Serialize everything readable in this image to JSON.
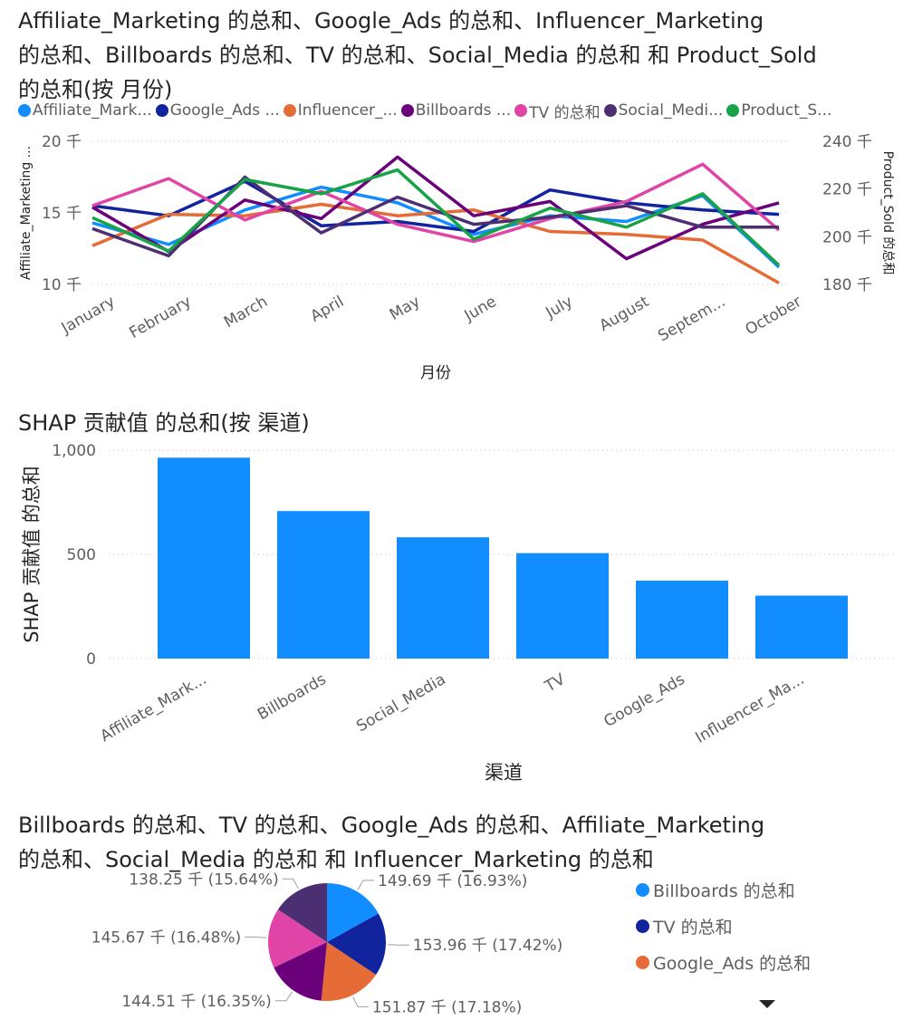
{
  "charts": {
    "line": {
      "title": "Affiliate_Marketing 的总和、Google_Ads 的总和、Influencer_Marketing 的总和、Billboards 的总和、TV 的总和、Social_Media 的总和 和 Product_Sold 的总和(按 月份)",
      "title_lines": [
        "Affiliate_Marketing 的总和、Google_Ads 的总和、Influencer_Marketing",
        "的总和、Billboards 的总和、TV 的总和、Social_Media 的总和 和 Product_Sold",
        "的总和(按 月份)"
      ],
      "legend_labels": [
        "Affiliate_Mark...",
        "Google_Ads ...",
        "Influencer_...",
        "Billboards ...",
        "TV 的总和",
        "Social_Medi...",
        "Product_S..."
      ]
    },
    "bar": {
      "title": "SHAP 贡献值 的总和(按 渠道)",
      "ylabel": "SHAP 贡献值 的总和",
      "xlabel": "渠道",
      "tick_labels": [
        "Affiliate_Mark...",
        "Billboards",
        "Social_Media",
        "TV",
        "Google_Ads",
        "Influencer_Ma..."
      ]
    },
    "pie": {
      "title_lines": [
        "Billboards 的总和、TV 的总和、Google_Ads 的总和、Affiliate_Marketing",
        "的总和、Social_Media 的总和 和 Influencer_Marketing 的总和"
      ],
      "legend_labels": [
        "Billboards 的总和",
        "TV 的总和",
        "Google_Ads 的总和"
      ]
    }
  },
  "chart_data": [
    {
      "type": "line",
      "title": "Affiliate_Marketing 的总和、Google_Ads 的总和、Influencer_Marketing 的总和、Billboards 的总和、TV 的总和、Social_Media 的总和 和 Product_Sold 的总和(按 月份)",
      "xlabel": "月份",
      "ylabel": "Affiliate_Marketing ...",
      "y2label": "Product_Sold 的总和",
      "categories": [
        "January",
        "February",
        "March",
        "April",
        "May",
        "June",
        "July",
        "August",
        "Septem...",
        "October"
      ],
      "ylim": [
        10000,
        20000
      ],
      "y_ticks": [
        "10 千",
        "15 千",
        "20 千"
      ],
      "y2lim": [
        180,
        240
      ],
      "y2_ticks": [
        "180 千",
        "200 千",
        "220 千",
        "240 千"
      ],
      "grid": true,
      "legend_position": "top",
      "series": [
        {
          "name": "Affiliate_Mark...",
          "axis": "left",
          "color": "#118DFF",
          "values": [
            14300,
            12800,
            15200,
            16800,
            15700,
            13500,
            14800,
            14400,
            16200,
            11200
          ]
        },
        {
          "name": "Google_Ads ...",
          "axis": "left",
          "color": "#12239E",
          "values": [
            15500,
            14800,
            17200,
            14100,
            14400,
            13700,
            16600,
            15700,
            15200,
            14900
          ]
        },
        {
          "name": "Influencer_...",
          "axis": "left",
          "color": "#E66C37",
          "values": [
            12700,
            14900,
            14800,
            15600,
            14800,
            15200,
            13700,
            13500,
            13100,
            10100
          ]
        },
        {
          "name": "Billboards ...",
          "axis": "left",
          "color": "#6B007B",
          "values": [
            15400,
            12300,
            15900,
            14600,
            18900,
            14800,
            15800,
            11800,
            14200,
            15700
          ]
        },
        {
          "name": "TV 的总和",
          "axis": "left",
          "color": "#E044A7",
          "values": [
            15500,
            17400,
            14500,
            16500,
            14200,
            13000,
            14600,
            15800,
            18400,
            13800
          ]
        },
        {
          "name": "Social_Medi...",
          "axis": "left",
          "color": "#4C2F72",
          "values": [
            13900,
            12000,
            17500,
            13600,
            16100,
            14200,
            14700,
            15500,
            14000,
            14000
          ]
        },
        {
          "name": "Product_S...",
          "axis": "right",
          "color": "#17A346",
          "values": [
            208,
            194,
            224,
            218,
            228,
            199,
            212,
            204,
            218,
            188
          ]
        }
      ]
    },
    {
      "type": "bar",
      "title": "SHAP 贡献值 的总和(按 渠道)",
      "xlabel": "渠道",
      "ylabel": "SHAP 贡献值 的总和",
      "categories": [
        "Affiliate_Mark...",
        "Billboards",
        "Social_Media",
        "TV",
        "Google_Ads",
        "Influencer_Ma..."
      ],
      "values": [
        964,
        708,
        582,
        506,
        374,
        302
      ],
      "ylim": [
        0,
        1000
      ],
      "y_ticks": [
        "0",
        "500",
        "1,000"
      ],
      "grid": true,
      "color": "#118DFF"
    },
    {
      "type": "pie",
      "title": "Billboards 的总和、TV 的总和、Google_Ads 的总和、Affiliate_Marketing 的总和、Social_Media 的总和 和 Influencer_Marketing 的总和",
      "slices": [
        {
          "label": "Billboards 的总和",
          "value": 149.69,
          "color": "#118DFF",
          "data_label": "149.69 千 (16.93%)"
        },
        {
          "label": "TV 的总和",
          "value": 153.96,
          "color": "#12239E",
          "data_label": "153.96 千 (17.42%)"
        },
        {
          "label": "Google_Ads 的总和",
          "value": 151.87,
          "color": "#E66C37",
          "data_label": "151.87 千 (17.18%)"
        },
        {
          "label": "",
          "value": 144.51,
          "color": "#6B007B",
          "data_label": "144.51 千 (16.35%)"
        },
        {
          "label": "",
          "value": 145.67,
          "color": "#E044A7",
          "data_label": "145.67 千 (16.48%)"
        },
        {
          "label": "",
          "value": 138.25,
          "color": "#4C2F72",
          "data_label": "138.25 千 (15.64%)"
        }
      ],
      "legend_position": "right"
    }
  ]
}
